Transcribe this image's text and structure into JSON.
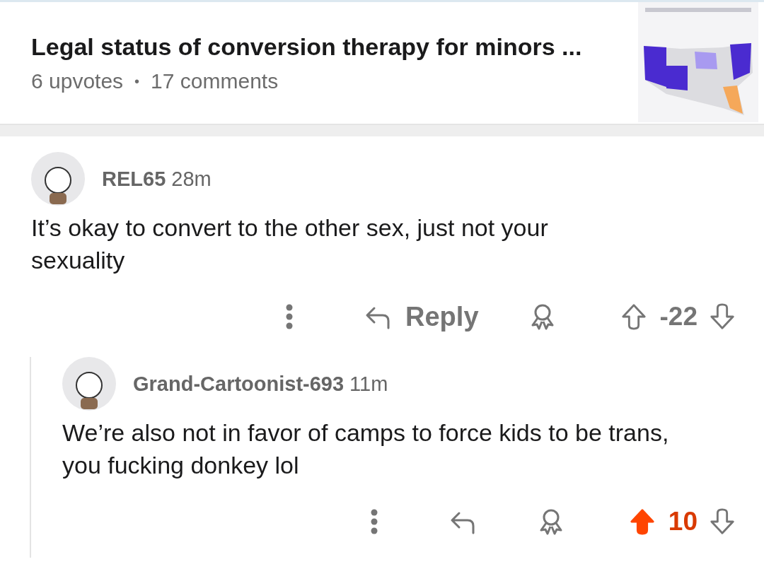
{
  "post": {
    "title": "Legal status of conversion therapy for minors ...",
    "upvotes": "6 upvotes",
    "separator": "•",
    "comments": "17 comments"
  },
  "comments": [
    {
      "author": "REL65",
      "time": "28m",
      "body": "It’s okay to convert to the other sex, just not your sexuality",
      "reply_label": "Reply",
      "score": "-22",
      "upvoted": false,
      "children": [
        {
          "author": "Grand-Cartoonist-693",
          "time": "11m",
          "body": "We’re also not in favor of camps to force kids to be trans, you fucking donkey lol",
          "score": "10",
          "upvoted": true
        }
      ]
    }
  ]
}
